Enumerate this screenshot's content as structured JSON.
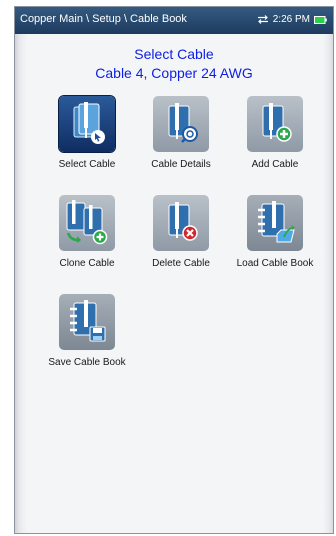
{
  "header": {
    "breadcrumb": "Copper Main \\ Setup \\ Cable Book",
    "time": "2:26 PM"
  },
  "selection": {
    "title": "Select Cable",
    "current": "Cable 4, Copper 24 AWG"
  },
  "tiles": [
    {
      "label": "Select Cable",
      "icon": "cable-select-icon",
      "active": true
    },
    {
      "label": "Cable Details",
      "icon": "cable-details-icon"
    },
    {
      "label": "Add Cable",
      "icon": "cable-add-icon"
    },
    {
      "label": "Clone Cable",
      "icon": "cable-clone-icon"
    },
    {
      "label": "Delete Cable",
      "icon": "cable-delete-icon"
    },
    {
      "label": "Load Cable Book",
      "icon": "cable-book-load-icon"
    },
    {
      "label": "Save Cable Book",
      "icon": "cable-book-save-icon"
    }
  ],
  "colors": {
    "header_bg": "#1d3b5e",
    "title_text": "#0d1fe3",
    "tile_bg": "#8f9aa6",
    "active_tile_bg": "#163a74"
  }
}
